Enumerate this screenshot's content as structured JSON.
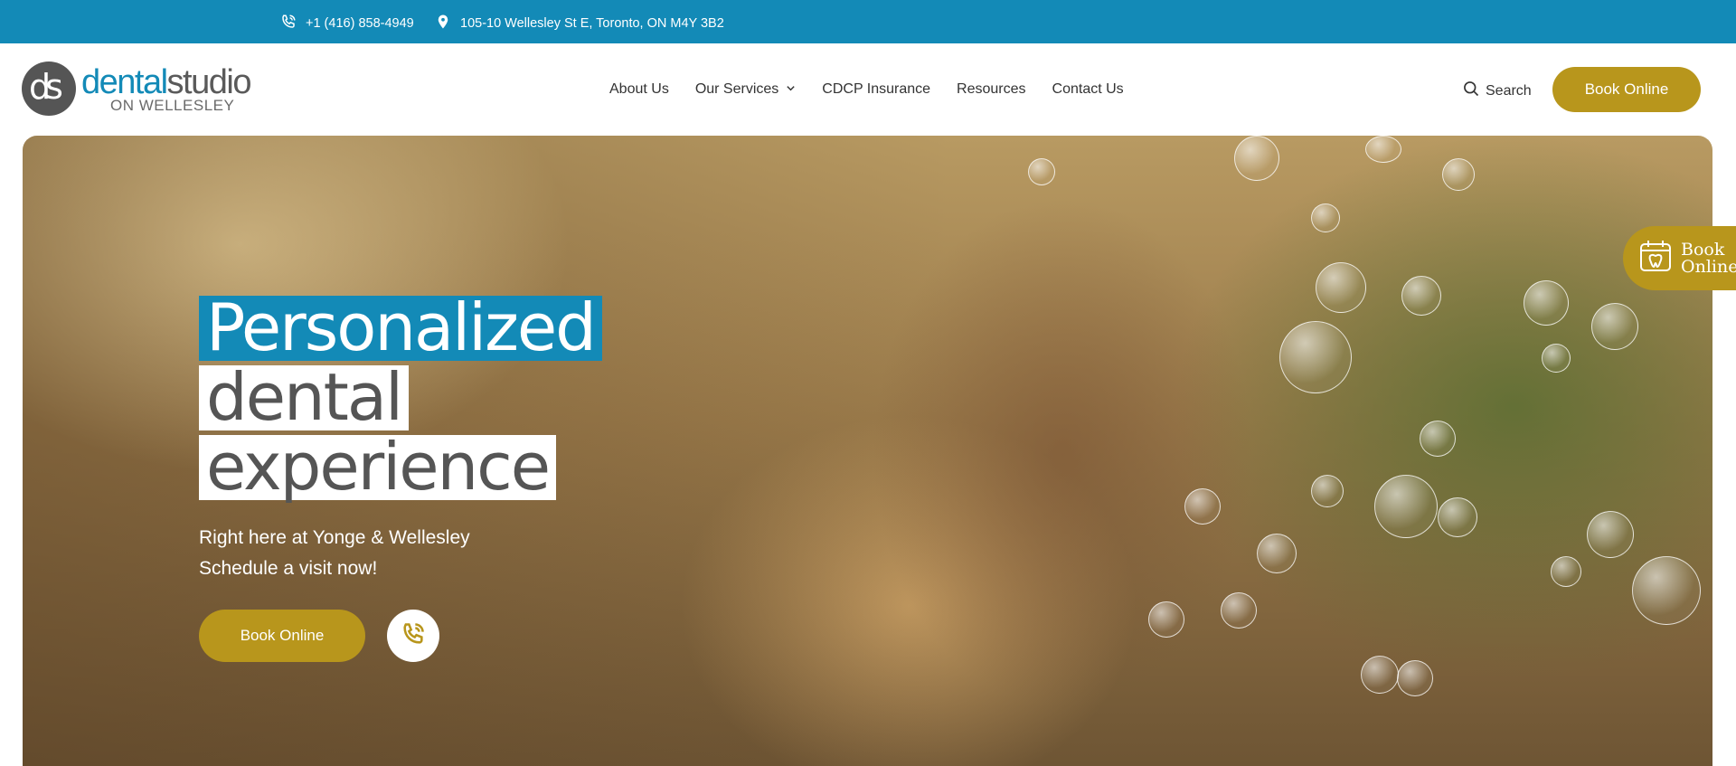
{
  "topbar": {
    "phone": "+1 (416) 858-4949",
    "address": "105-10 Wellesley St E, Toronto, ON M4Y 3B2",
    "background": "#138ab7"
  },
  "logo": {
    "mark": "ds",
    "word_a": "dental",
    "word_b": "studio",
    "sub": "ON WELLESLEY"
  },
  "nav": {
    "items": [
      {
        "label": "About Us"
      },
      {
        "label": "Our Services",
        "has_dropdown": true
      },
      {
        "label": "CDCP Insurance"
      },
      {
        "label": "Resources"
      },
      {
        "label": "Contact Us"
      }
    ]
  },
  "header": {
    "search_label": "Search",
    "book_label": "Book Online"
  },
  "hero": {
    "headline": [
      "Personalized",
      "dental",
      "experience"
    ],
    "subtitle_line1": "Right here at Yonge & Wellesley",
    "subtitle_line2": "Schedule a visit now!",
    "book_label": "Book Online"
  },
  "float_tab": {
    "line1": "Book",
    "line2": "Online"
  },
  "colors": {
    "brand_blue": "#138ab7",
    "accent_gold": "#b8961c"
  },
  "icons": [
    "phone-icon",
    "map-pin-icon",
    "chevron-down-icon",
    "search-icon",
    "calendar-tooth-icon"
  ]
}
